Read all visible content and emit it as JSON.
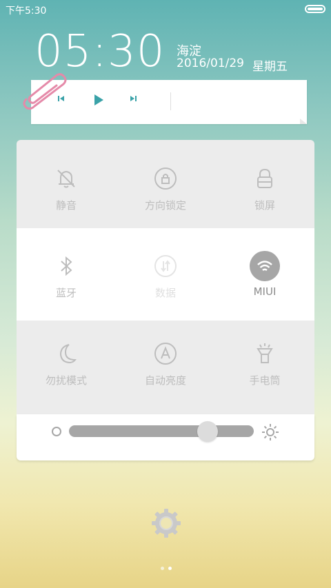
{
  "status_bar": {
    "time": "下午5:30"
  },
  "lockscreen": {
    "clock": "05:30",
    "location": "海淀",
    "date": "2016/01/29",
    "weekday": "星期五"
  },
  "music_widget": {
    "controls": [
      "prev",
      "play",
      "next"
    ]
  },
  "toggles": [
    {
      "label": "静音",
      "icon": "bell-off-icon",
      "active": false
    },
    {
      "label": "方向锁定",
      "icon": "rotation-lock-icon",
      "active": false
    },
    {
      "label": "锁屏",
      "icon": "lock-icon",
      "active": false
    },
    {
      "label": "蓝牙",
      "icon": "bluetooth-icon",
      "active": false
    },
    {
      "label": "数据",
      "icon": "data-icon",
      "active": false
    },
    {
      "label": "MIUI",
      "icon": "wifi-icon",
      "active": true
    },
    {
      "label": "勿扰模式",
      "icon": "moon-icon",
      "active": false
    },
    {
      "label": "自动亮度",
      "icon": "auto-brightness-icon",
      "active": false
    },
    {
      "label": "手电筒",
      "icon": "flashlight-icon",
      "active": false
    }
  ],
  "brightness": {
    "level": 0.75
  },
  "page_indicator": {
    "count": 2,
    "active": 1
  },
  "colors": {
    "accent": "#3aa2a8",
    "toggle_active": "#a6a6a6",
    "toggle_inactive": "#bdbdbd"
  }
}
